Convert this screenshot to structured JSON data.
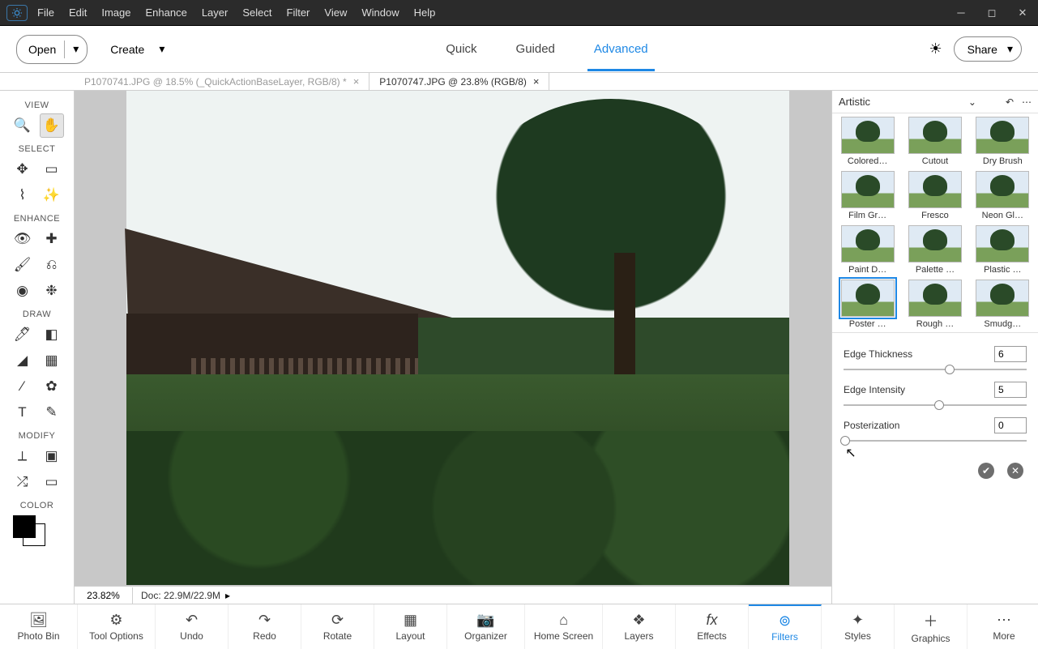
{
  "menubar": [
    "File",
    "Edit",
    "Image",
    "Enhance",
    "Layer",
    "Select",
    "Filter",
    "View",
    "Window",
    "Help"
  ],
  "toolbar": {
    "open": "Open",
    "create": "Create",
    "modes": [
      "Quick",
      "Guided",
      "Advanced"
    ],
    "active_mode": "Advanced",
    "share": "Share"
  },
  "doc_tabs": [
    {
      "label": "P1070741.JPG @ 18.5% (_QuickActionBaseLayer, RGB/8) *",
      "active": false
    },
    {
      "label": "P1070747.JPG @ 23.8% (RGB/8)",
      "active": true
    }
  ],
  "tool_sections": {
    "view": "VIEW",
    "select": "SELECT",
    "enhance": "ENHANCE",
    "draw": "DRAW",
    "modify": "MODIFY",
    "color": "COLOR"
  },
  "right_panel": {
    "category": "Artistic",
    "filters": [
      "Colored…",
      "Cutout",
      "Dry Brush",
      "Film Gr…",
      "Fresco",
      "Neon Gl…",
      "Paint D…",
      "Palette …",
      "Plastic …",
      "Poster …",
      "Rough …",
      "Smudg…"
    ],
    "selected_filter": "Poster …",
    "sliders": [
      {
        "label": "Edge Thickness",
        "value": "6",
        "pos": 58
      },
      {
        "label": "Edge Intensity",
        "value": "5",
        "pos": 52
      },
      {
        "label": "Posterization",
        "value": "0",
        "pos": 1
      }
    ]
  },
  "status": {
    "zoom": "23.82%",
    "doc": "Doc: 22.9M/22.9M"
  },
  "taskbar": [
    "Photo Bin",
    "Tool Options",
    "Undo",
    "Redo",
    "Rotate",
    "Layout",
    "Organizer",
    "Home Screen",
    "Layers",
    "Effects",
    "Filters",
    "Styles",
    "Graphics",
    "More"
  ],
  "taskbar_active": "Filters"
}
